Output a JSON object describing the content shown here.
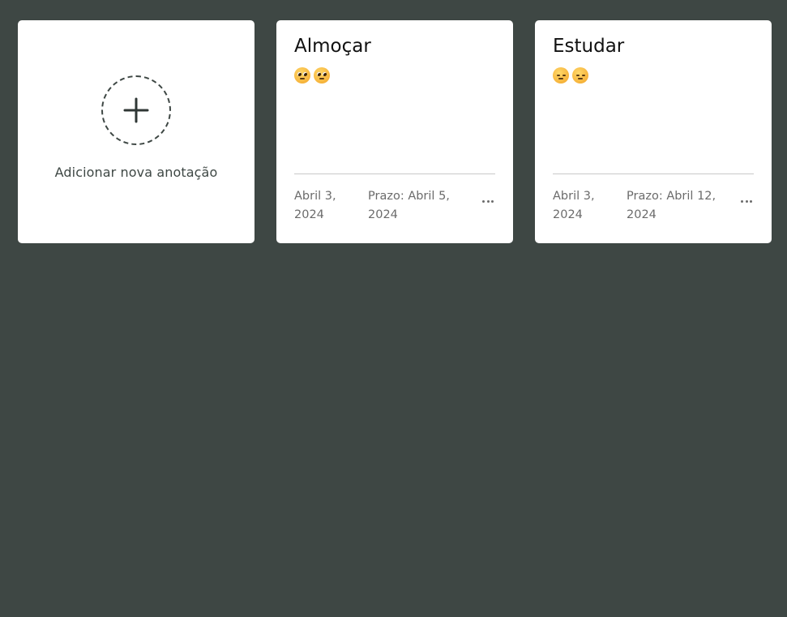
{
  "add_card": {
    "label": "Adicionar nova anotação",
    "icon": "plus-icon"
  },
  "notes": [
    {
      "title": "Almoçar",
      "emoji": [
        "pleading-face",
        "pleading-face"
      ],
      "created_line1": "Abril 3,",
      "created_line2": "2024",
      "deadline_line1": "Prazo: Abril 5,",
      "deadline_line2": "2024",
      "menu_icon": "more-horizontal-icon"
    },
    {
      "title": "Estudar",
      "emoji": [
        "pensive-face",
        "pensive-face"
      ],
      "created_line1": "Abril 3,",
      "created_line2": "2024",
      "deadline_line1": "Prazo: Abril 12,",
      "deadline_line2": "2024",
      "menu_icon": "more-horizontal-icon"
    }
  ],
  "colors": {
    "background": "#3e4744",
    "card": "#ffffff",
    "text_muted": "#6b6b6b"
  }
}
